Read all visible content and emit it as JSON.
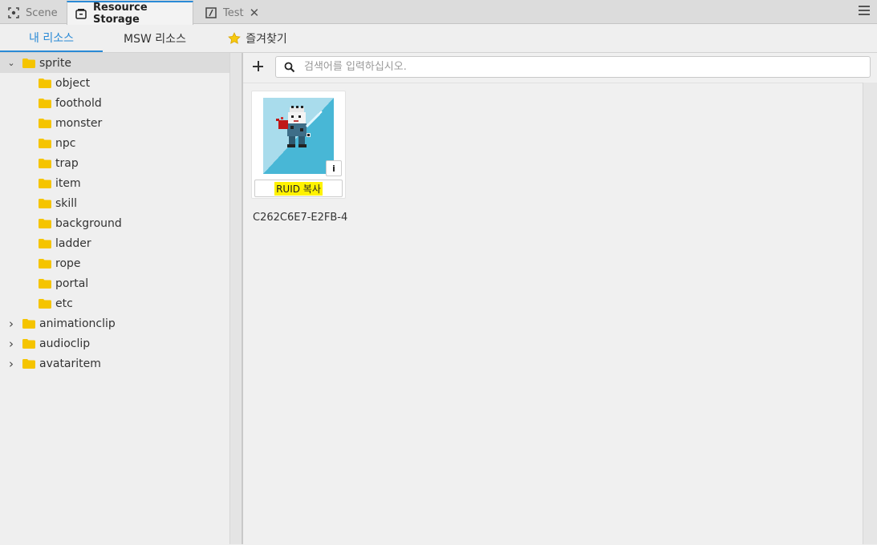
{
  "tabs": [
    {
      "label": "Scene",
      "icon": "scene-focus-icon"
    },
    {
      "label": "Resource Storage",
      "icon": "storage-box-icon"
    },
    {
      "label": "Test",
      "icon": "script-file-icon",
      "close": "✕"
    }
  ],
  "subtabs": {
    "my_resources": "내 리소스",
    "msw_resources": "MSW 리소스",
    "favorites": "즐겨찾기"
  },
  "tree": {
    "root": {
      "label": "sprite",
      "expanded": true
    },
    "children": [
      "object",
      "foothold",
      "monster",
      "npc",
      "trap",
      "item",
      "skill",
      "background",
      "ladder",
      "rope",
      "portal",
      "etc"
    ],
    "siblings": [
      "animationclip",
      "audioclip",
      "avataritem"
    ],
    "expand_glyph": "›",
    "collapse_glyph": "⌄"
  },
  "search": {
    "placeholder": "검색어를 입력하십시오."
  },
  "resource": {
    "copy_label": "RUID 복사",
    "info_glyph": "i",
    "caption": "C262C6E7-E2FB-4"
  },
  "colors": {
    "accent": "#2a8ad6",
    "folder": "#f5c400",
    "highlight": "#fff200",
    "thumb_light": "#a9dcec",
    "thumb_dark": "#48b7d6"
  }
}
